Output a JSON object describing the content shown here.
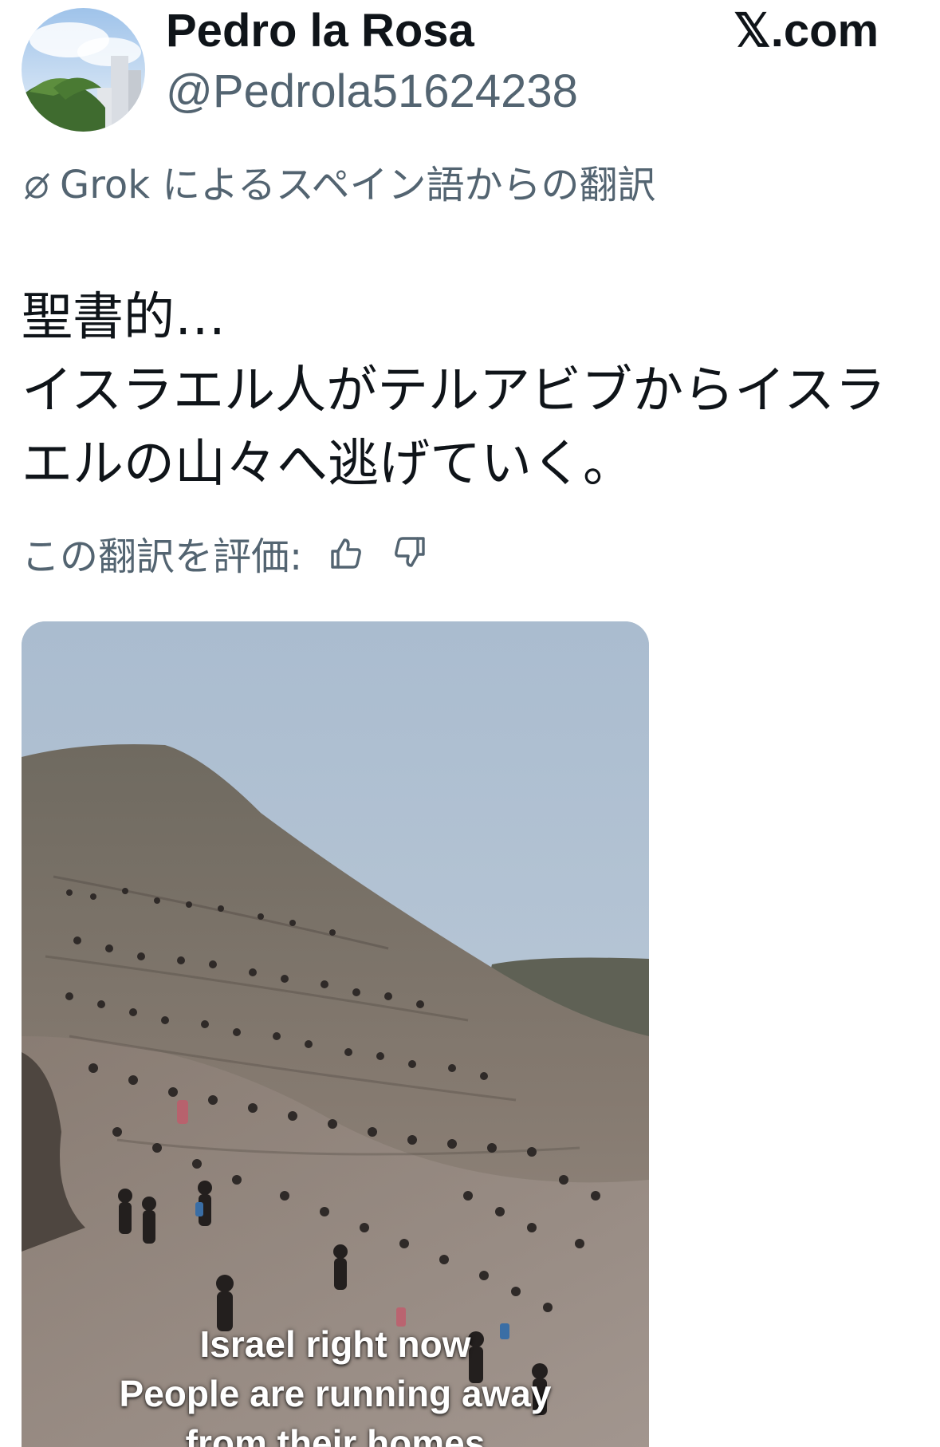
{
  "header": {
    "display_name": "Pedro la Rosa",
    "handle": "@Pedrola51624238",
    "site": "𝕏.com",
    "avatar_icon": "profile-avatar"
  },
  "translation": {
    "label": "Grok によるスペイン語からの翻訳",
    "icon": "grok-icon"
  },
  "tweet": {
    "lines": [
      "聖書的…",
      "イスラエル人がテルアビブからイスラ",
      "エルの山々へ逃げていく。"
    ]
  },
  "rating": {
    "label": "この翻訳を評価:",
    "thumbs_up_icon": "thumbs-up-icon",
    "thumbs_down_icon": "thumbs-down-icon"
  },
  "media": {
    "caption_lines": [
      "Israel right now",
      "People are running away",
      "from their homes"
    ]
  },
  "colors": {
    "text_primary": "#0f1419",
    "text_secondary": "#536471",
    "sky": "#b7c6d5",
    "mountain": "#7d7269"
  }
}
